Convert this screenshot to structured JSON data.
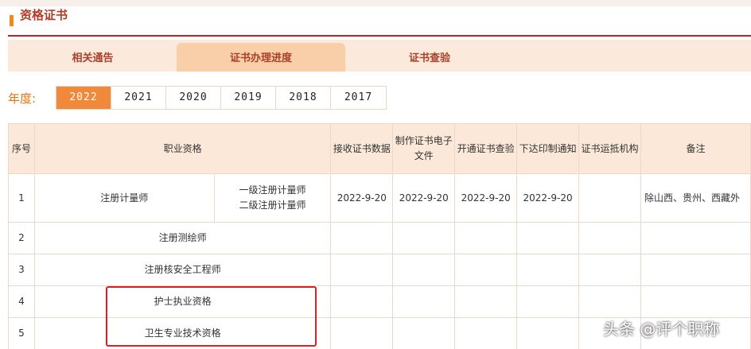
{
  "section": {
    "title": "资格证书"
  },
  "tabs": [
    {
      "label": "相关通告"
    },
    {
      "label": "证书办理进度"
    },
    {
      "label": "证书查验"
    }
  ],
  "year_filter": {
    "label": "年度:",
    "years": [
      "2022",
      "2021",
      "2020",
      "2019",
      "2018",
      "2017"
    ],
    "selected": "2022"
  },
  "table": {
    "headers": {
      "index": "序号",
      "qualification": "职业资格",
      "receive": "接收证书数据",
      "make": "制作证书电子文件",
      "open": "开通证书查验",
      "issue": "下达印制通知",
      "ship": "证书运抵机构",
      "note": "备注"
    },
    "rows": [
      {
        "index": "1",
        "qualification": "注册计量师",
        "sub1": "一级注册计量师",
        "sub2": "二级注册计量师",
        "receive": "2022-9-20",
        "make": "2022-9-20",
        "open": "2022-9-20",
        "issue": "2022-9-20",
        "ship": "",
        "note": "除山西、贵州、西藏外"
      },
      {
        "index": "2",
        "qualification": "注册测绘师"
      },
      {
        "index": "3",
        "qualification": "注册核安全工程师"
      },
      {
        "index": "4",
        "qualification": "护士执业资格"
      },
      {
        "index": "5",
        "qualification": "卫生专业技术资格"
      }
    ]
  },
  "watermark": "头条 @评个职称",
  "colors": {
    "accent": "#b8232a",
    "tab_bg": "#fbe9dc",
    "tab_active": "#f9cfa9",
    "year_active": "#f08a3a",
    "header_bg": "#fbe8d8",
    "highlight": "#e02020"
  }
}
